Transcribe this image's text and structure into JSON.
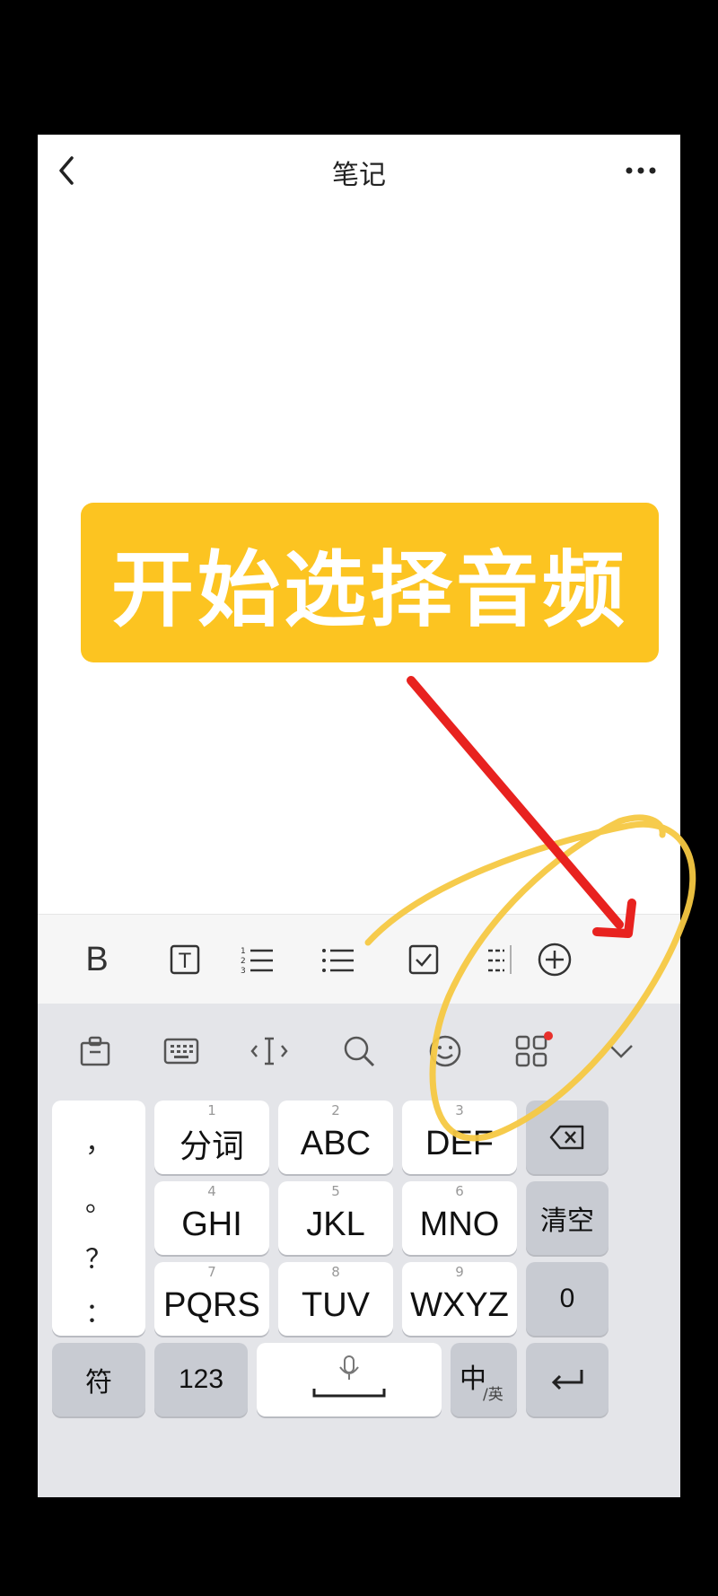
{
  "header": {
    "title": "笔记",
    "back_icon": "chevron-left-icon",
    "more_icon": "more-horizontal-icon"
  },
  "banner": {
    "text": "开始选择音频",
    "color": "#fcc421"
  },
  "format_toolbar": {
    "items": [
      {
        "label": "B",
        "icon": "bold-icon"
      },
      {
        "label": "T",
        "icon": "text-style-icon"
      },
      {
        "label": "123",
        "icon": "numbered-list-icon"
      },
      {
        "label": "",
        "icon": "bulleted-list-icon"
      },
      {
        "label": "",
        "icon": "checkbox-icon"
      },
      {
        "label": "",
        "icon": "divider-icon"
      },
      {
        "label": "",
        "icon": "add-circle-icon"
      }
    ]
  },
  "keyboard": {
    "toolbar_icons": [
      "clipboard-icon",
      "keyboard-icon",
      "cursor-move-icon",
      "search-icon",
      "emoji-icon",
      "apps-grid-icon",
      "collapse-chevron-icon"
    ],
    "punctuation": [
      "，",
      "。",
      "？",
      "："
    ],
    "keys": {
      "k1": {
        "num": "1",
        "label": "分词"
      },
      "k2": {
        "num": "2",
        "label": "ABC"
      },
      "k3": {
        "num": "3",
        "label": "DEF"
      },
      "k4": {
        "num": "4",
        "label": "GHI"
      },
      "k5": {
        "num": "5",
        "label": "JKL"
      },
      "k6": {
        "num": "6",
        "label": "MNO"
      },
      "k7": {
        "num": "7",
        "label": "PQRS"
      },
      "k8": {
        "num": "8",
        "label": "TUV"
      },
      "k9": {
        "num": "9",
        "label": "WXYZ"
      },
      "clear": "清空",
      "zero": "0",
      "symbol": "符",
      "numeric": "123",
      "lang_main": "中",
      "lang_sub": "/英"
    },
    "accent_dot_color": "#e8302c"
  },
  "annotation": {
    "arrow_color": "#e8221f",
    "circle_color": "#f5c842"
  }
}
